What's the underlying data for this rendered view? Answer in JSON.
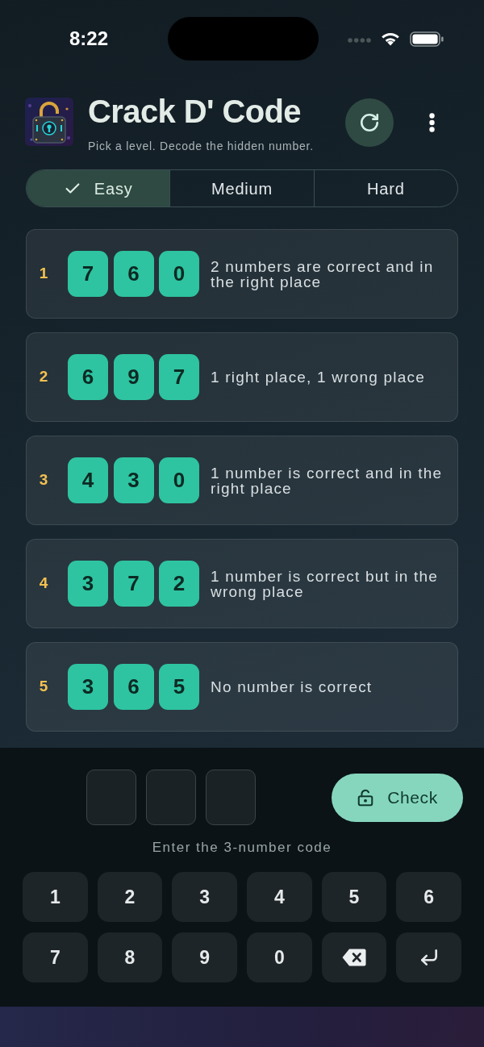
{
  "status_bar": {
    "time": "8:22"
  },
  "header": {
    "title": "Crack D' Code",
    "subtitle": "Pick a level. Decode the hidden number."
  },
  "levels": [
    {
      "label": "Easy",
      "selected": true
    },
    {
      "label": "Medium",
      "selected": false
    },
    {
      "label": "Hard",
      "selected": false
    }
  ],
  "clues": [
    {
      "number": "1",
      "digits": [
        "7",
        "6",
        "0"
      ],
      "hint": "2 numbers are correct and in the right place"
    },
    {
      "number": "2",
      "digits": [
        "6",
        "9",
        "7"
      ],
      "hint": "1 right place, 1 wrong place"
    },
    {
      "number": "3",
      "digits": [
        "4",
        "3",
        "0"
      ],
      "hint": "1 number is correct and in the right place"
    },
    {
      "number": "4",
      "digits": [
        "3",
        "7",
        "2"
      ],
      "hint": "1 number is correct but in the wrong place"
    },
    {
      "number": "5",
      "digits": [
        "3",
        "6",
        "5"
      ],
      "hint": "No number is correct"
    }
  ],
  "entry": {
    "fields": [
      {
        "focused": false
      },
      {
        "focused": false
      },
      {
        "focused": false
      }
    ],
    "check_button": "Check",
    "hint": "Enter the 3-number code"
  },
  "keypad": [
    {
      "kind": "digit",
      "label": "1"
    },
    {
      "kind": "digit",
      "label": "2"
    },
    {
      "kind": "digit",
      "label": "3"
    },
    {
      "kind": "digit",
      "label": "4"
    },
    {
      "kind": "digit",
      "label": "5"
    },
    {
      "kind": "digit",
      "label": "6"
    },
    {
      "kind": "digit",
      "label": "7"
    },
    {
      "kind": "digit",
      "label": "8"
    },
    {
      "kind": "digit",
      "label": "9"
    },
    {
      "kind": "digit",
      "label": "0"
    },
    {
      "kind": "backspace"
    },
    {
      "kind": "enter"
    }
  ]
}
